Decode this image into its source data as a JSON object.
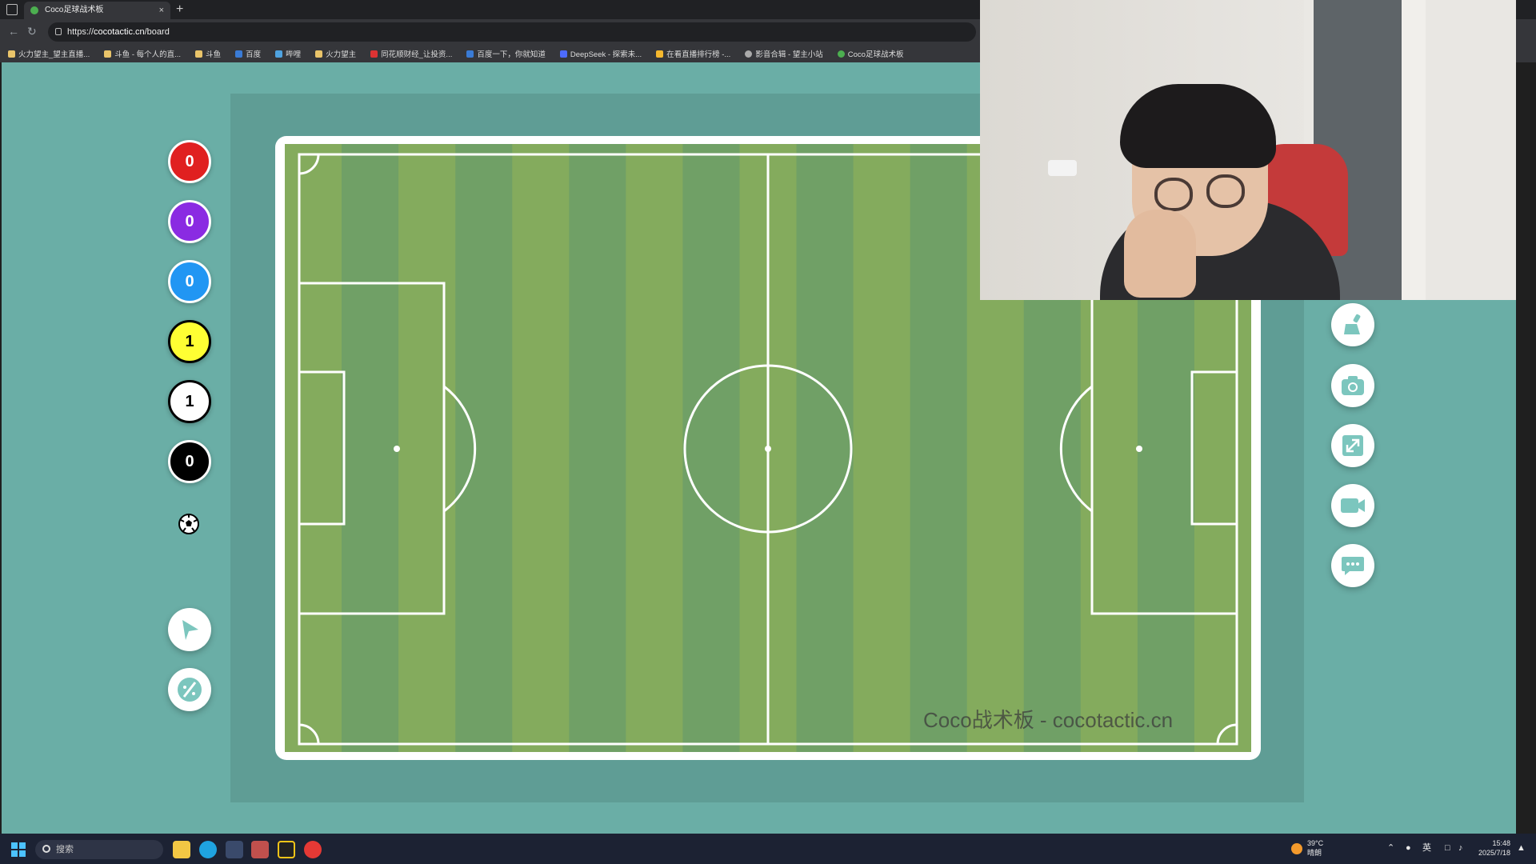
{
  "browser": {
    "tab_title": "Coco足球战术板",
    "tab_close": "×",
    "new_tab": "+",
    "url_prefix": "https://",
    "url_domain": "cocotactic.cn",
    "url_path": "/board",
    "bookmarks": [
      "火力望主_望主直播...",
      "斗鱼 - 每个人的直...",
      "斗鱼",
      "百度",
      "哔哩",
      "火力望主",
      "同花顺财经_让投资...",
      "百度一下，你就知道",
      "DeepSeek - 探索未...",
      "在看直播排行榜 -...",
      "影音合辑 - 望主小站",
      "Coco足球战术板"
    ]
  },
  "counters": [
    {
      "value": "0",
      "color": "#e02020"
    },
    {
      "value": "0",
      "color": "#8a2be2"
    },
    {
      "value": "0",
      "color": "#2196f3"
    },
    {
      "value": "1",
      "color": "#ffff33"
    },
    {
      "value": "1",
      "color": "#ffffff"
    },
    {
      "value": "0",
      "color": "#000000"
    }
  ],
  "left_tools": [
    "cursor-arrow-icon",
    "palette-icon"
  ],
  "right_tools": [
    "broom-icon",
    "camera-icon",
    "expand-icon",
    "video-camera-icon",
    "chat-icon"
  ],
  "watermark": "Coco战术板 - cocotactic.cn",
  "colors": {
    "page_bg": "#6aaea6",
    "board_bg": "#5f9d95",
    "stripe_light": "#84ab5d",
    "stripe_dark": "#70a066",
    "accent_icon": "#7cc6be"
  },
  "taskbar": {
    "search_placeholder": "搜索",
    "weather_temp": "39°C",
    "weather_desc": "晴朗",
    "ime": "英",
    "time": "15:48",
    "date": "2025/7/18"
  }
}
